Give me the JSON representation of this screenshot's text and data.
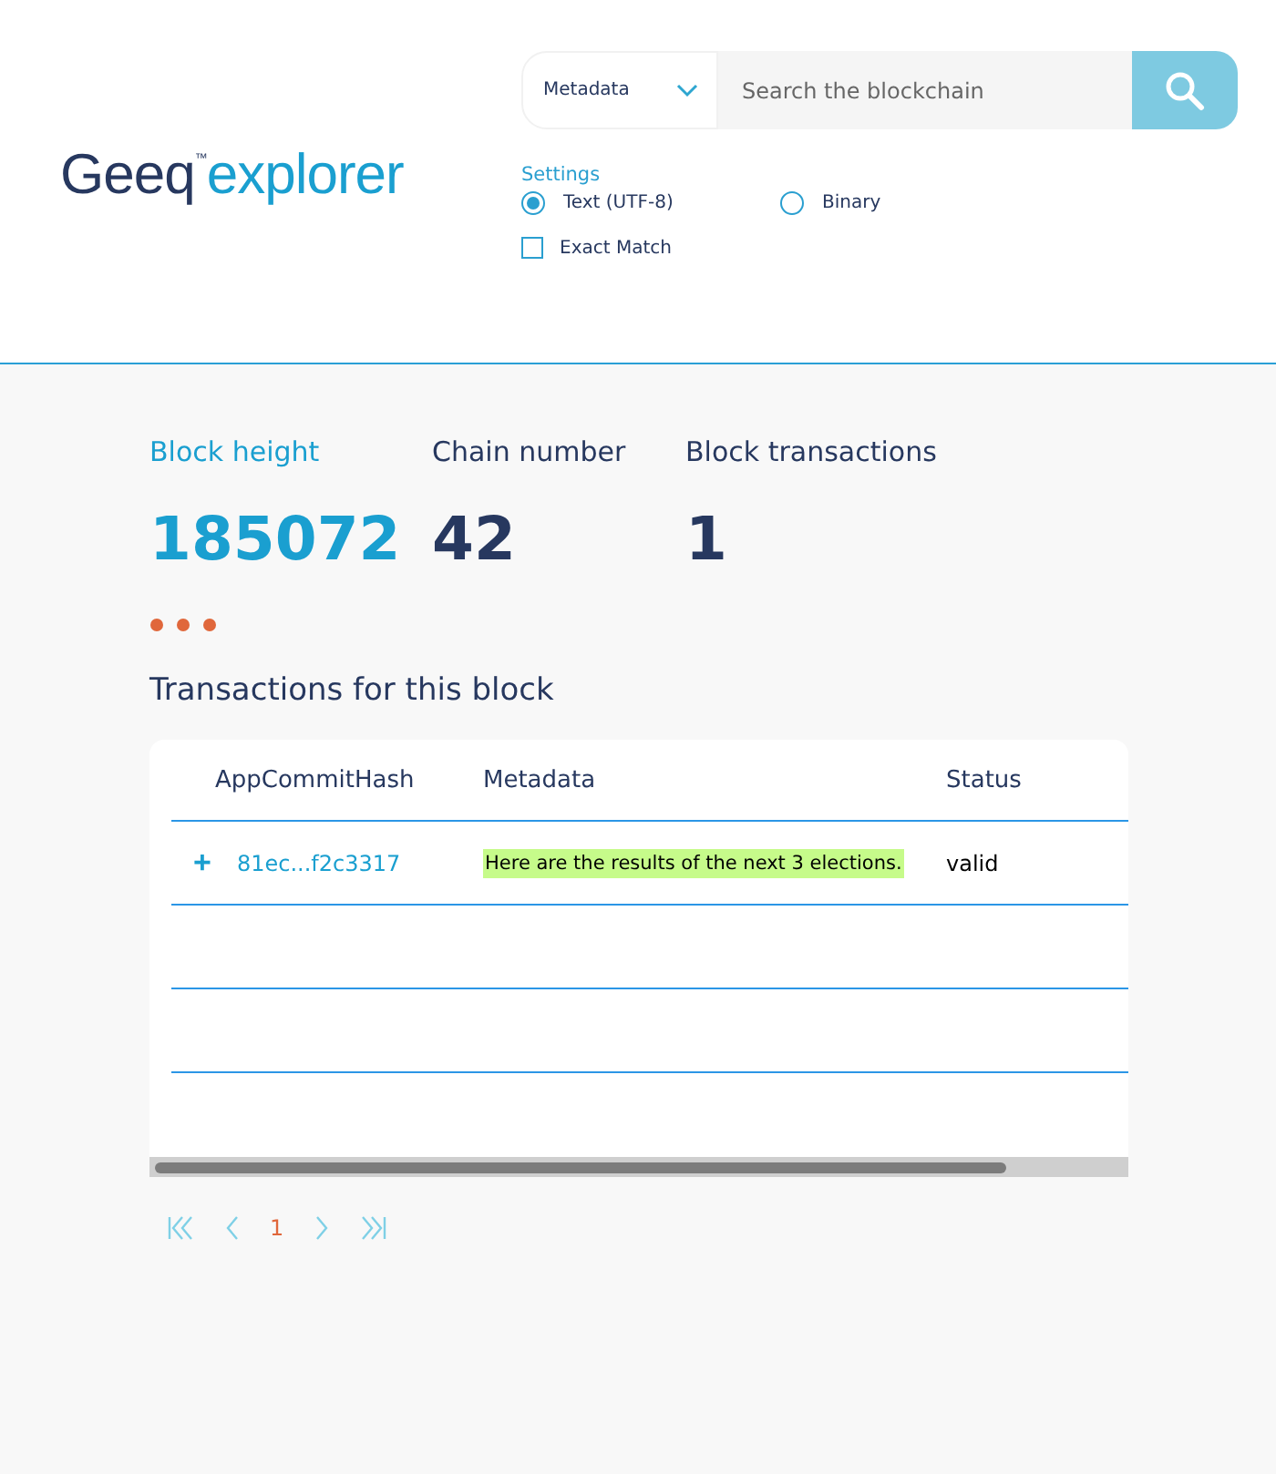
{
  "logo": {
    "brand": "Geeq",
    "mark": "™",
    "product": "explorer"
  },
  "search": {
    "type_select": "Metadata",
    "placeholder": "Search the blockchain"
  },
  "settings": {
    "title": "Settings",
    "encodings": [
      {
        "label": "Text (UTF-8)",
        "selected": true
      },
      {
        "label": "Binary",
        "selected": false
      }
    ],
    "exact_match": {
      "label": "Exact Match",
      "checked": false
    }
  },
  "stats": [
    {
      "label": "Block height",
      "value": "185072",
      "highlight": true
    },
    {
      "label": "Chain number",
      "value": "42",
      "highlight": false
    },
    {
      "label": "Block transactions",
      "value": "1",
      "highlight": false
    }
  ],
  "transactions": {
    "title": "Transactions for this block",
    "columns": [
      "AppCommitHash",
      "Metadata",
      "Status"
    ],
    "rows": [
      {
        "expand": "+",
        "hash": "81ec...f2c3317",
        "metadata": "Here are the results of the next 3 elections.",
        "status": "valid"
      }
    ]
  },
  "pagination": {
    "pages": [
      {
        "label": "1",
        "selected": true
      }
    ]
  }
}
